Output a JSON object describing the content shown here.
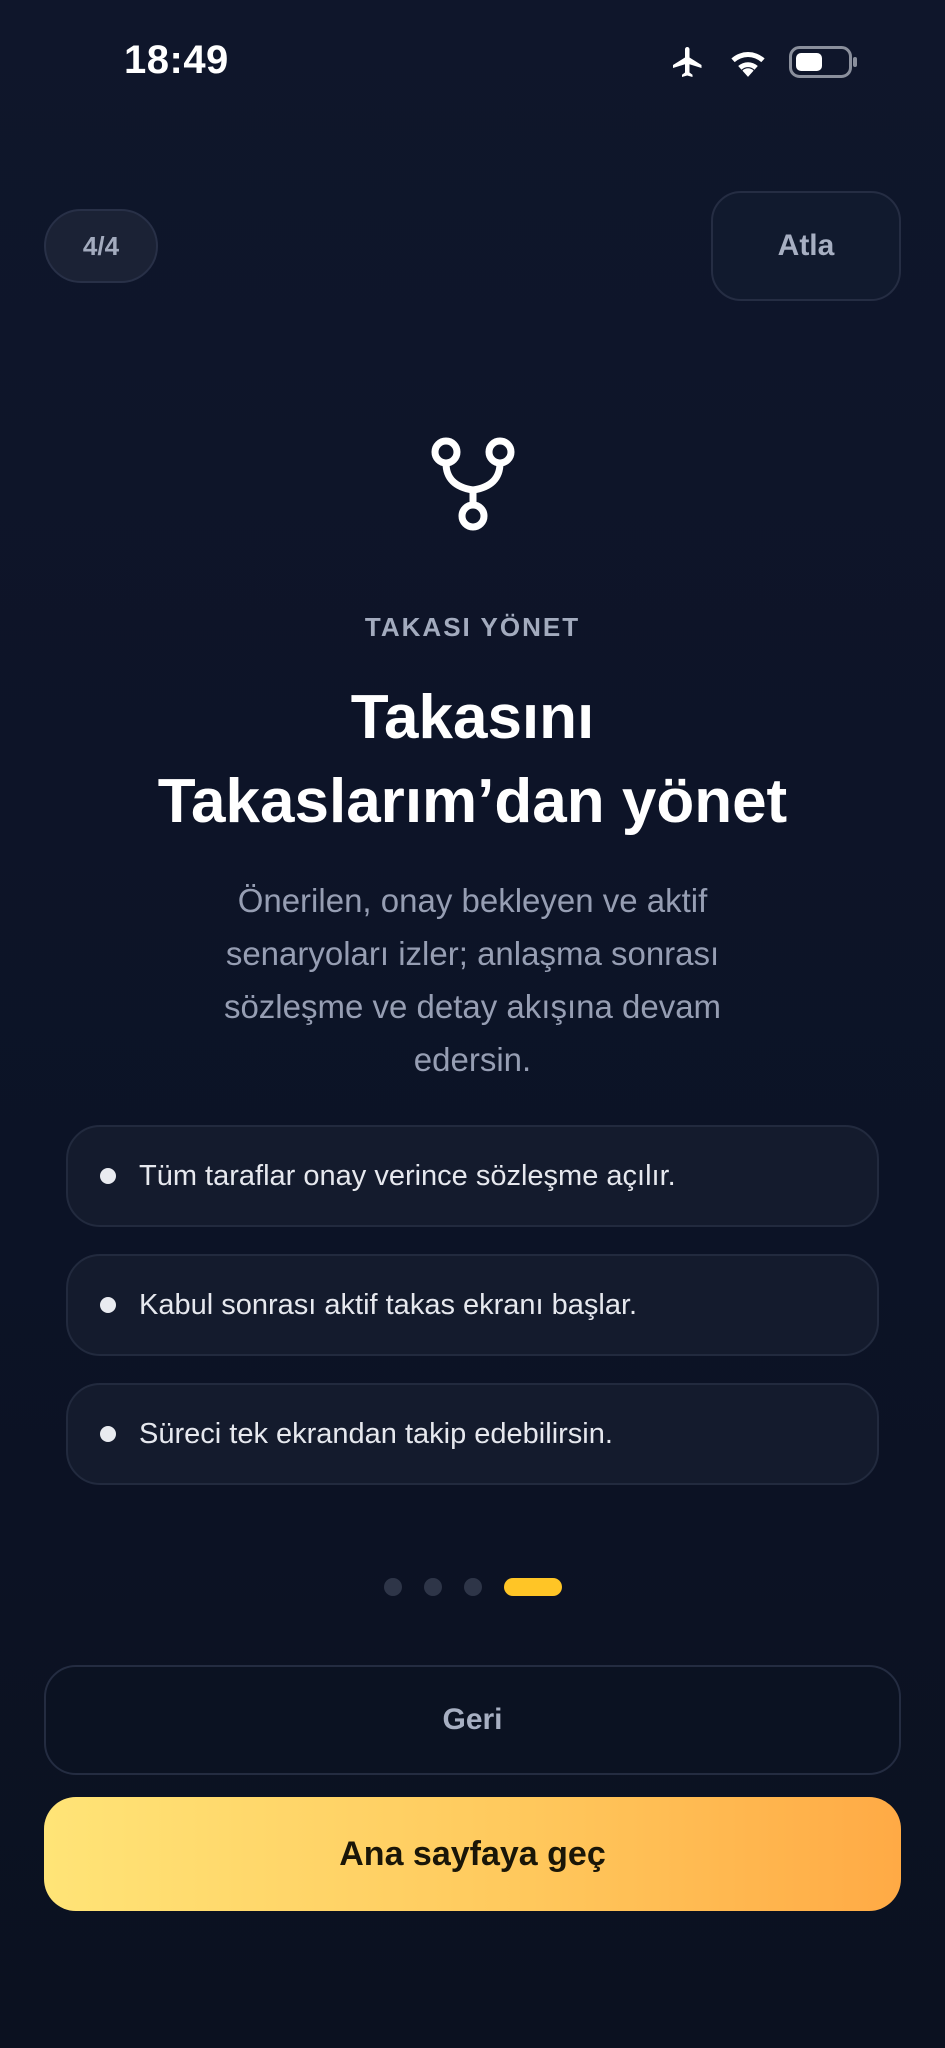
{
  "status_bar": {
    "time": "18:49",
    "icons": [
      "airplane-icon",
      "wifi-icon",
      "battery-icon"
    ]
  },
  "header": {
    "step_label": "4/4",
    "skip_label": "Atla"
  },
  "hero": {
    "icon": "branch-icon",
    "eyebrow": "TAKASI YÖNET",
    "title_line1": "Takasını",
    "title_line2": "Takaslarım’dan yönet",
    "description": "Önerilen, onay bekleyen ve aktif senaryoları izler; anlaşma sonrası sözleşme ve detay akışına devam edersin."
  },
  "features": [
    {
      "text": "Tüm taraflar onay verince sözleşme açılır."
    },
    {
      "text": "Kabul sonrası aktif takas ekranı başlar."
    },
    {
      "text": "Süreci tek ekrandan takip edebilirsin."
    }
  ],
  "pagination": {
    "total": 4,
    "current": 4
  },
  "actions": {
    "back_label": "Geri",
    "primary_label": "Ana sayfaya geç"
  },
  "colors": {
    "background": "#0d1427",
    "accent": "#ffc526",
    "primary_gradient_start": "#ffe477",
    "primary_gradient_end": "#ffaa45"
  }
}
